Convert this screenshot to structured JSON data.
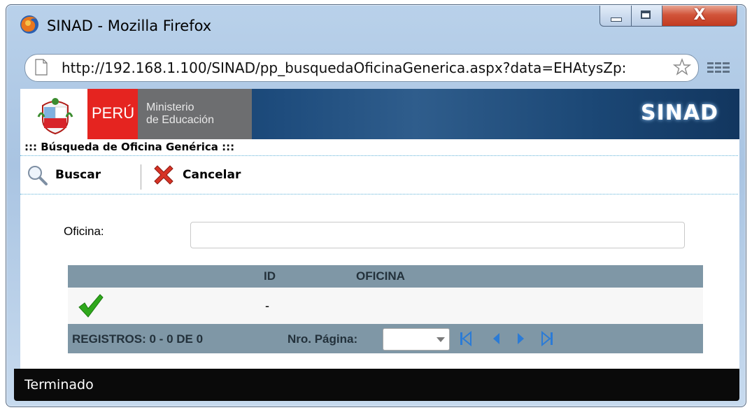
{
  "window": {
    "title": "SINAD - Mozilla Firefox",
    "controls": {
      "minimize": "minimize",
      "maximize": "maximize",
      "close_glyph": "X"
    }
  },
  "browser": {
    "url": "http://192.168.1.100/SINAD/pp_busquedaOficinaGenerica.aspx?data=EHAtysZp:",
    "status": "Terminado"
  },
  "banner": {
    "country": "PERÚ",
    "ministry_line1": "Ministerio",
    "ministry_line2": "de Educación",
    "app_name": "SINAD",
    "colors": {
      "red": "#e52420",
      "gray": "#6d6e70",
      "blue": "#1d4b7c"
    }
  },
  "page": {
    "section_title": "::: Búsqueda de Oficina Genérica :::",
    "toolbar": {
      "search_label": "Buscar",
      "cancel_label": "Cancelar"
    },
    "form": {
      "office_label": "Oficina:",
      "office_value": "",
      "office_placeholder": ""
    },
    "grid": {
      "columns": [
        "",
        "ID",
        "OFICINA"
      ],
      "rows": [
        {
          "icon": "check-icon",
          "id": "-",
          "office": ""
        }
      ],
      "footer": {
        "records": "REGISTROS: 0 - 0 DE 0",
        "page_label": "Nro. Página:",
        "page_value": ""
      },
      "header_color": "#7f97a6"
    }
  }
}
